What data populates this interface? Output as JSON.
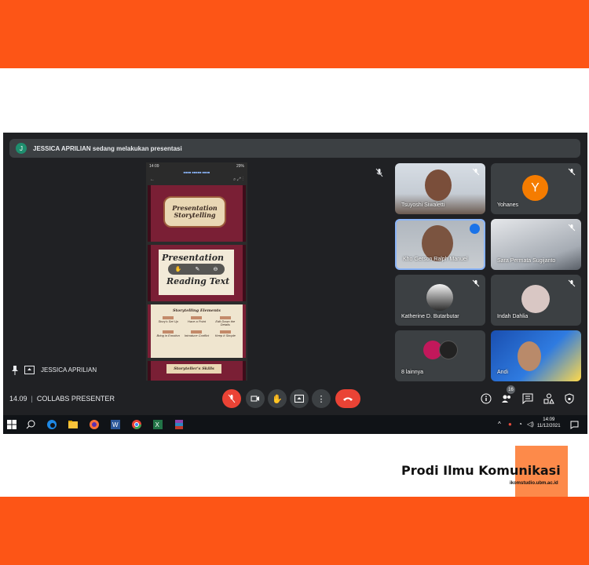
{
  "colors": {
    "band": "#fd5516",
    "meet_bg": "#202124",
    "tile_bg": "#3c4043",
    "danger": "#ea4335",
    "accent_blue": "#1a73e8"
  },
  "banner": {
    "avatar_initial": "J",
    "text": "JESSICA APRILIAN sedang melakukan presentasi"
  },
  "presentation": {
    "slide1_line1": "Presentation",
    "slide1_line2": "Storytelling",
    "slide2_line1": "Presentation",
    "slide2_line2": "Reading Text",
    "slide3_title": "Storytelling Elements",
    "elements": [
      "Story's Set Up",
      "Have a Point",
      "Edit Down the Details",
      "Bring in Emotion",
      "Introduce Conflict",
      "Keep It Simple"
    ],
    "slide4_title": "Storyteller's Skills"
  },
  "presenter_label": "JESSICA APRILIAN",
  "participants": {
    "tsuyoshi": "Tsuyoshi Siwaletti",
    "yohanes": "Yohanes",
    "yohanes_initial": "Y",
    "kho": "Kho Gerson Ralph Manuel",
    "sara": "Sara Permata Sugijanto",
    "katherine": "Katherine D. Butarbutar",
    "indah": "Indah Dahlia",
    "lainnya": "8 lainnya",
    "andi": "Andi"
  },
  "footer": {
    "time": "14.09",
    "separator": "|",
    "meeting_name": "COLLABS PRESENTER",
    "people_count": "16"
  },
  "taskbar": {
    "clock_time": "14:09",
    "clock_date": "11/12/2021"
  },
  "branding": {
    "title": "Prodi Ilmu Komunikasi",
    "url": "ikomstudio.ubm.ac.id"
  }
}
